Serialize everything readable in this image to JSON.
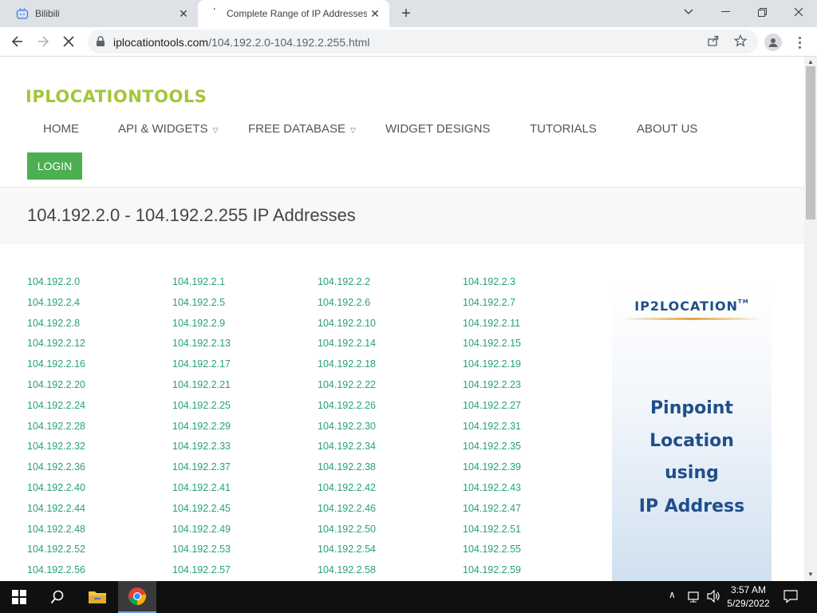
{
  "browser": {
    "tabs": [
      {
        "title": "Bilibili",
        "active": false
      },
      {
        "title": "Complete Range of IP Addresses",
        "active": true
      }
    ],
    "new_tab_label": "+",
    "url_domain": "iplocationtools.com",
    "url_path": "/104.192.2.0-104.192.2.255.html"
  },
  "site": {
    "logo": "IPLOCATIONTOOLS",
    "nav": [
      {
        "label": "HOME",
        "dropdown": false
      },
      {
        "label": "API & WIDGETS",
        "dropdown": true
      },
      {
        "label": "FREE DATABASE",
        "dropdown": true
      },
      {
        "label": "WIDGET DESIGNS",
        "dropdown": false
      },
      {
        "label": "TUTORIALS",
        "dropdown": false
      },
      {
        "label": "ABOUT US",
        "dropdown": false
      }
    ],
    "login_label": "LOGIN",
    "accent_color": "#4caf50",
    "link_color": "#27a36f"
  },
  "page_title": "104.192.2.0 - 104.192.2.255 IP Addresses",
  "ip_addresses": [
    "104.192.2.0",
    "104.192.2.1",
    "104.192.2.2",
    "104.192.2.3",
    "104.192.2.4",
    "104.192.2.5",
    "104.192.2.6",
    "104.192.2.7",
    "104.192.2.8",
    "104.192.2.9",
    "104.192.2.10",
    "104.192.2.11",
    "104.192.2.12",
    "104.192.2.13",
    "104.192.2.14",
    "104.192.2.15",
    "104.192.2.16",
    "104.192.2.17",
    "104.192.2.18",
    "104.192.2.19",
    "104.192.2.20",
    "104.192.2.21",
    "104.192.2.22",
    "104.192.2.23",
    "104.192.2.24",
    "104.192.2.25",
    "104.192.2.26",
    "104.192.2.27",
    "104.192.2.28",
    "104.192.2.29",
    "104.192.2.30",
    "104.192.2.31",
    "104.192.2.32",
    "104.192.2.33",
    "104.192.2.34",
    "104.192.2.35",
    "104.192.2.36",
    "104.192.2.37",
    "104.192.2.38",
    "104.192.2.39",
    "104.192.2.40",
    "104.192.2.41",
    "104.192.2.42",
    "104.192.2.43",
    "104.192.2.44",
    "104.192.2.45",
    "104.192.2.46",
    "104.192.2.47",
    "104.192.2.48",
    "104.192.2.49",
    "104.192.2.50",
    "104.192.2.51",
    "104.192.2.52",
    "104.192.2.53",
    "104.192.2.54",
    "104.192.2.55",
    "104.192.2.56",
    "104.192.2.57",
    "104.192.2.58",
    "104.192.2.59"
  ],
  "ad": {
    "brand": "IP2LOCATION",
    "trademark": "TM",
    "lines": [
      "Pinpoint",
      "Location",
      "using",
      "IP Address"
    ]
  },
  "taskbar": {
    "time": "3:57 AM",
    "date": "5/29/2022"
  }
}
